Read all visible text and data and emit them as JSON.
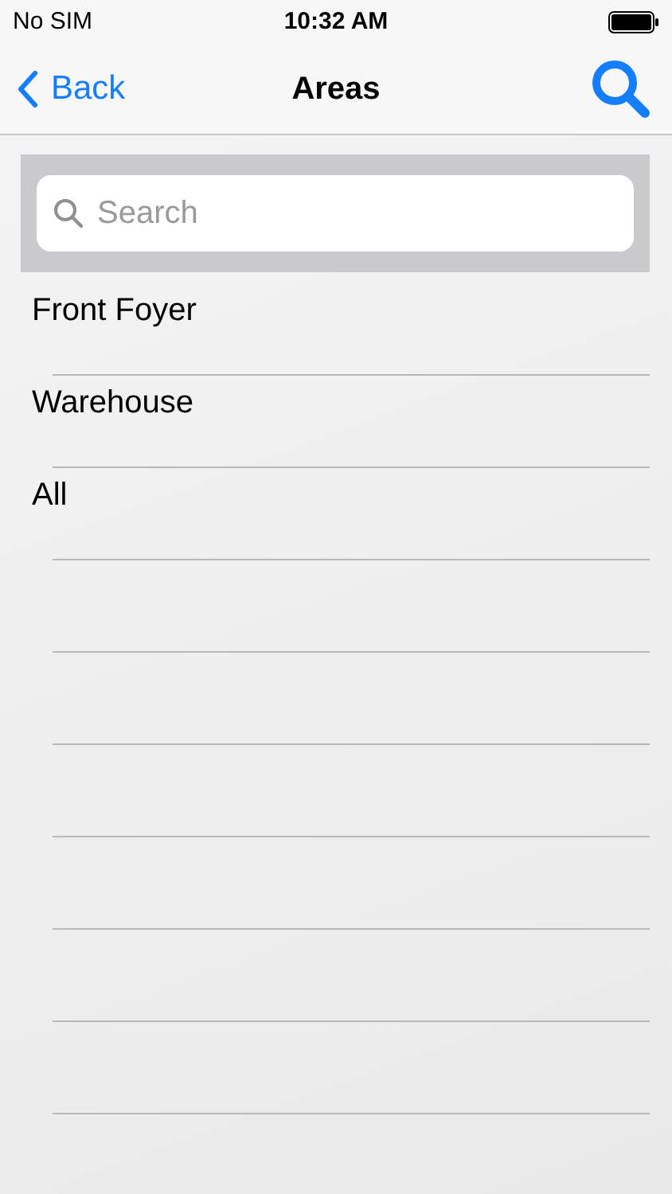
{
  "status_bar": {
    "carrier": "No SIM",
    "time": "10:32 AM"
  },
  "nav": {
    "back_label": "Back",
    "title": "Areas"
  },
  "search": {
    "placeholder": "Search"
  },
  "items": [
    {
      "label": "Front Foyer"
    },
    {
      "label": "Warehouse"
    },
    {
      "label": "All"
    }
  ]
}
